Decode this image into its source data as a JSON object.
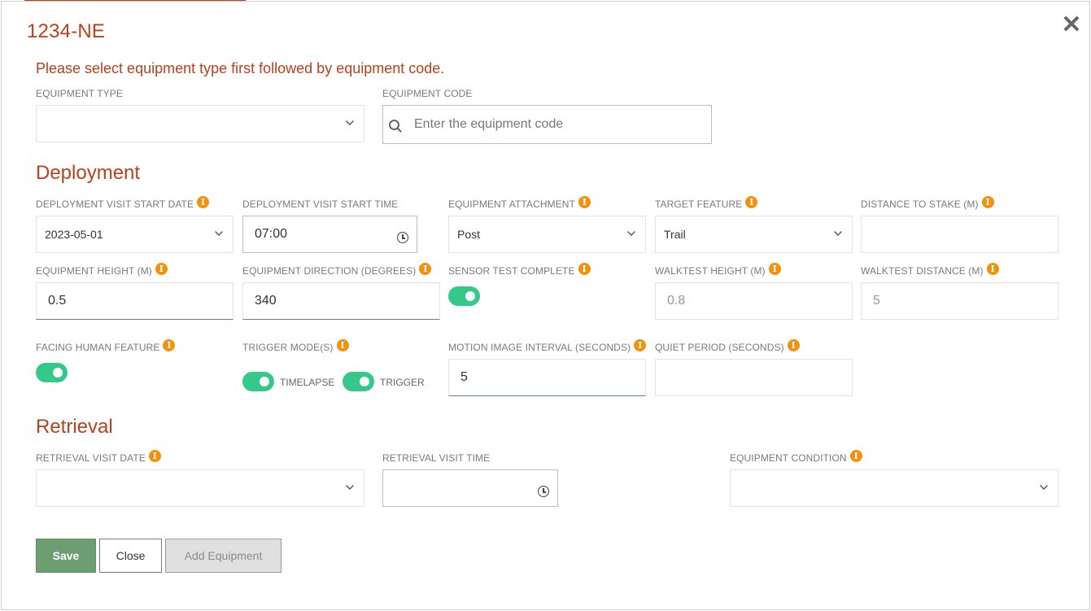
{
  "modal": {
    "title": "1234-NE",
    "notice": "Please select equipment type first followed by equipment code.",
    "close_glyph": "✕"
  },
  "equipment": {
    "type_label": "EQUIPMENT TYPE",
    "type_value": "",
    "code_label": "EQUIPMENT CODE",
    "code_placeholder": "Enter the equipment code"
  },
  "deployment": {
    "heading": "Deployment",
    "start_date": {
      "label": "DEPLOYMENT VISIT START DATE",
      "value": "2023-05-01"
    },
    "start_time": {
      "label": "DEPLOYMENT VISIT START TIME",
      "value": "07:00"
    },
    "attachment": {
      "label": "EQUIPMENT ATTACHMENT",
      "value": "Post"
    },
    "target_feature": {
      "label": "TARGET FEATURE",
      "value": "Trail"
    },
    "distance_to_stake": {
      "label": "DISTANCE TO STAKE (M)",
      "value": ""
    },
    "equipment_height": {
      "label": "EQUIPMENT HEIGHT (M)",
      "value": "0.5"
    },
    "equipment_direction": {
      "label": "EQUIPMENT DIRECTION (DEGREES)",
      "value": "340"
    },
    "sensor_test": {
      "label": "SENSOR TEST COMPLETE",
      "on": true
    },
    "walktest_height": {
      "label": "WALKTEST HEIGHT (M)",
      "value": "0.8"
    },
    "walktest_distance": {
      "label": "WALKTEST DISTANCE (M)",
      "value": "5"
    },
    "facing_human": {
      "label": "FACING HUMAN FEATURE",
      "on": true
    },
    "trigger_modes": {
      "label": "TRIGGER MODE(S)",
      "timelapse": "TIMELAPSE",
      "trigger": "TRIGGER"
    },
    "motion_interval": {
      "label": "MOTION IMAGE INTERVAL (SECONDS)",
      "value": "5"
    },
    "quiet_period": {
      "label": "QUIET PERIOD (SECONDS)",
      "value": ""
    }
  },
  "retrieval": {
    "heading": "Retrieval",
    "visit_date": {
      "label": "RETRIEVAL VISIT DATE",
      "value": ""
    },
    "visit_time": {
      "label": "RETRIEVAL VISIT TIME",
      "value": ""
    },
    "condition": {
      "label": "EQUIPMENT CONDITION",
      "value": ""
    }
  },
  "buttons": {
    "save": "Save",
    "close": "Close",
    "add": "Add Equipment"
  },
  "info_glyph": "i",
  "colors": {
    "accent": "#b8401c",
    "info": "#f5900a",
    "toggle_on": "#34c98a",
    "save_button": "#6d9e72"
  }
}
